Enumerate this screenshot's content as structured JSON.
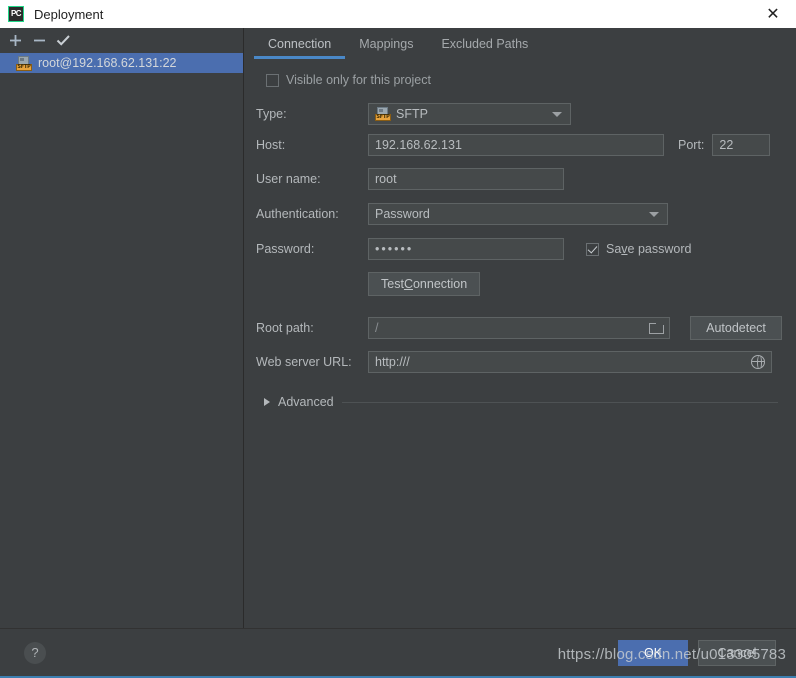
{
  "window": {
    "title": "Deployment",
    "app_icon": "PC",
    "close_icon": "close-icon"
  },
  "left_panel": {
    "toolbar": [
      {
        "name": "add-server-button",
        "icon": "plus-icon",
        "label": "+"
      },
      {
        "name": "remove-server-button",
        "icon": "minus-icon",
        "label": "−"
      },
      {
        "name": "set-default-server-button",
        "icon": "check-icon",
        "label": "✓"
      }
    ],
    "servers": [
      {
        "label": "root@192.168.62.131:22",
        "type_badge": "SFTP",
        "selected": true
      }
    ]
  },
  "tabs": [
    {
      "label": "Connection",
      "active": true
    },
    {
      "label": "Mappings",
      "active": false
    },
    {
      "label": "Excluded Paths",
      "active": false
    }
  ],
  "connection": {
    "visible_only": {
      "label": "Visible only for this project",
      "checked": false
    },
    "type": {
      "label": "Type:",
      "value": "SFTP",
      "badge": "SFTP"
    },
    "host": {
      "label": "Host:",
      "value": "192.168.62.131"
    },
    "port": {
      "label": "Port:",
      "value": "22"
    },
    "user_name": {
      "label": "User name:",
      "value": "root"
    },
    "authentication": {
      "label": "Authentication:",
      "value": "Password"
    },
    "password": {
      "label": "Password:",
      "value": "••••••"
    },
    "save_password": {
      "label_pre": "Sa",
      "label_mn": "v",
      "label_post": "e password",
      "checked": true
    },
    "test_connection": {
      "label_pre": "Test ",
      "label_mn": "C",
      "label_post": "onnection"
    },
    "root_path": {
      "label": "Root path:",
      "value": "/",
      "browse_icon": "folder-icon"
    },
    "autodetect": {
      "label": "Autodetect"
    },
    "web_server_url": {
      "label": "Web server URL:",
      "value": "http:///",
      "open_icon": "globe-icon"
    },
    "advanced": {
      "label": "Advanced",
      "expanded": false
    }
  },
  "footer": {
    "help": "?",
    "ok": "OK",
    "cancel": "Cancel"
  },
  "watermark": {
    "text": "https://blog.csdn.net/u013305783"
  }
}
